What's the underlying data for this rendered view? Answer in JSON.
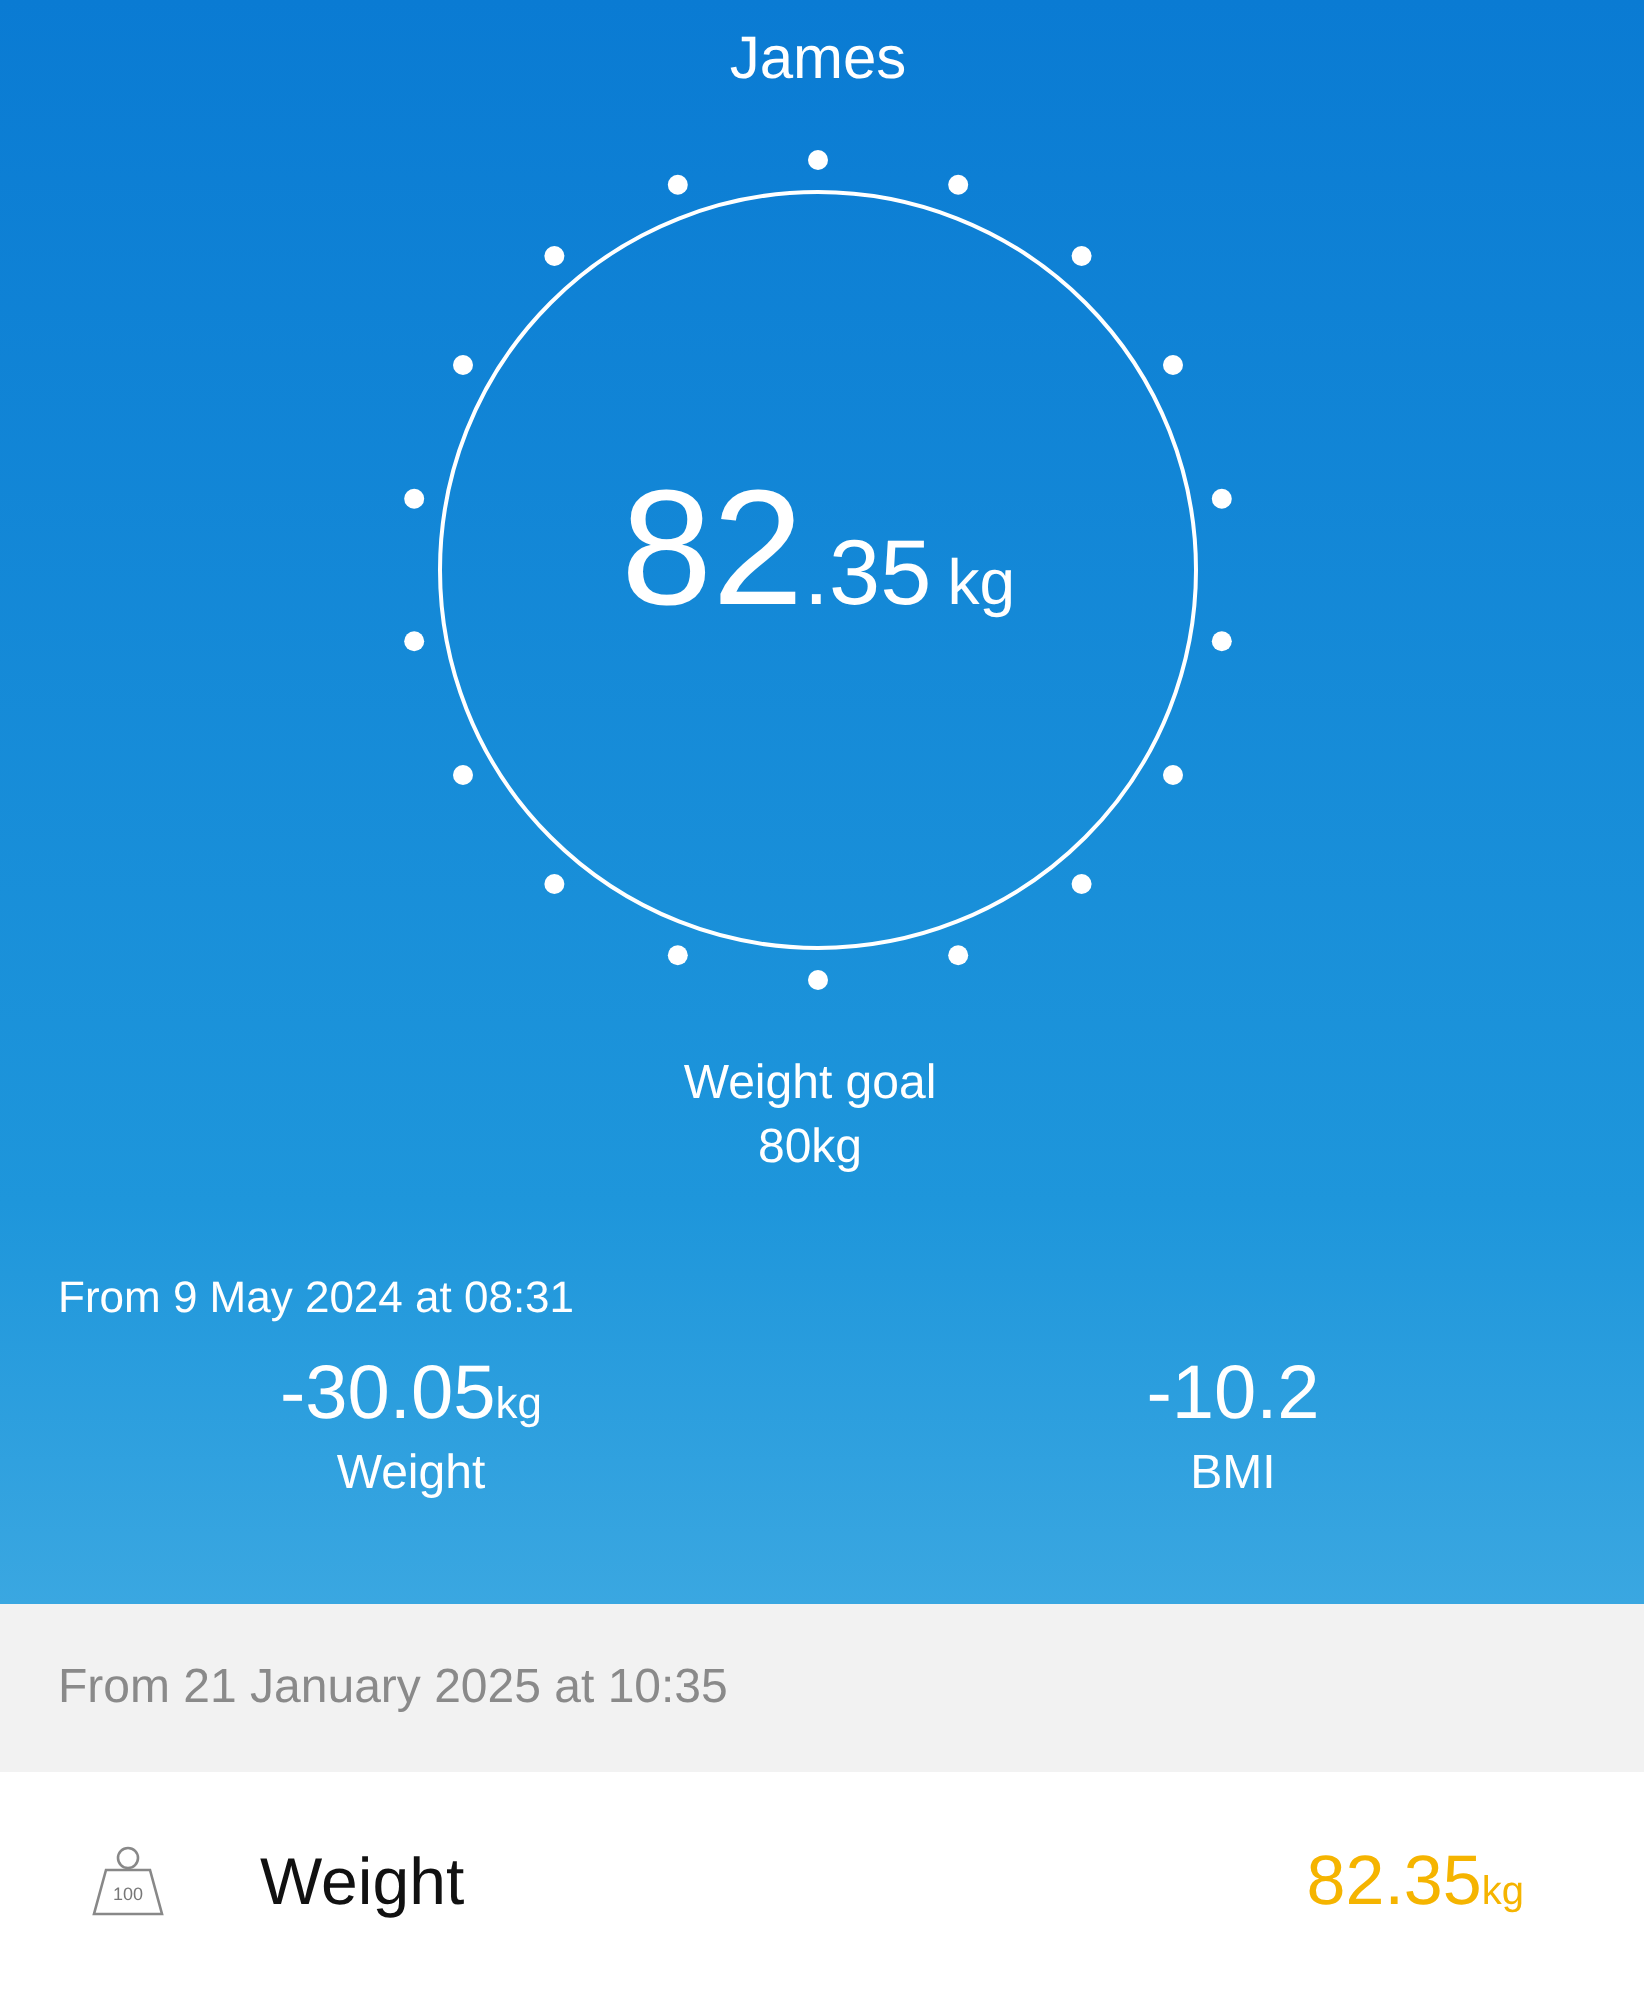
{
  "user": {
    "name": "James"
  },
  "current": {
    "whole": "82",
    "decimal": ".35",
    "unit": "kg"
  },
  "goal": {
    "label": "Weight goal",
    "value": "80kg"
  },
  "since": {
    "title": "From 9 May 2024 at 08:31",
    "stats": [
      {
        "value": "-30.05",
        "unit": "kg",
        "label": "Weight"
      },
      {
        "value": "-10.2",
        "label": "BMI"
      }
    ]
  },
  "section": {
    "title": "From 21 January 2025 at 10:35"
  },
  "measurements": [
    {
      "kind": "weight",
      "icon_label": "100",
      "label": "Weight",
      "value": "82.35",
      "unit": "kg",
      "color": "#f5b400"
    }
  ]
}
